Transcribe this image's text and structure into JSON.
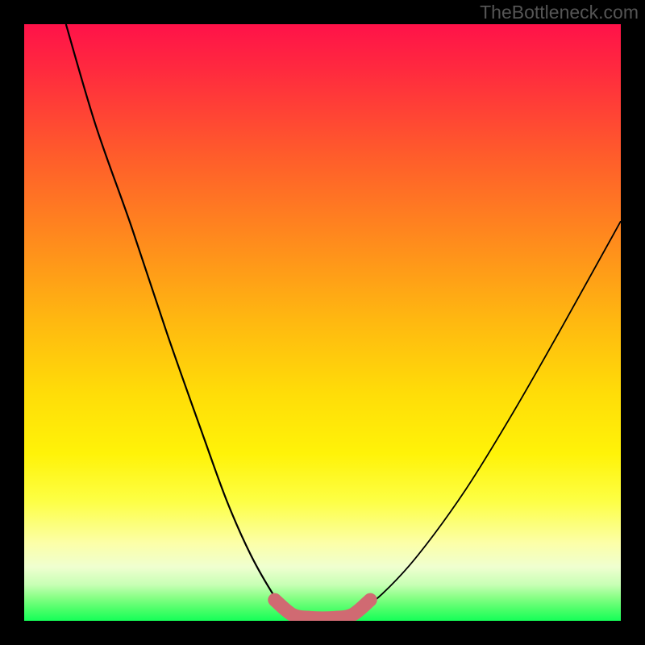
{
  "watermark": "TheBottleneck.com",
  "chart_data": {
    "type": "line",
    "title": "",
    "xlabel": "",
    "ylabel": "",
    "xlim": [
      0,
      100
    ],
    "ylim": [
      0,
      100
    ],
    "series": [
      {
        "name": "left-curve",
        "x": [
          7,
          12,
          18,
          24,
          30,
          34,
          38,
          42,
          44,
          46
        ],
        "y": [
          100,
          83,
          66,
          48,
          31,
          20,
          11,
          4,
          1.5,
          0.5
        ]
      },
      {
        "name": "right-curve",
        "x": [
          54,
          56,
          60,
          66,
          74,
          82,
          90,
          100
        ],
        "y": [
          0.5,
          1.5,
          4.5,
          11,
          22,
          35,
          49,
          67
        ]
      },
      {
        "name": "bottom-highlight",
        "x": [
          42,
          45,
          48,
          52,
          55,
          58
        ],
        "y": [
          3.5,
          1.0,
          0.5,
          0.5,
          1.0,
          3.5
        ]
      }
    ],
    "colors": {
      "curve": "#000000",
      "highlight": "#d06a72",
      "gradient_top": "#ff1249",
      "gradient_mid": "#ffdd08",
      "gradient_bottom": "#15ff58"
    }
  }
}
